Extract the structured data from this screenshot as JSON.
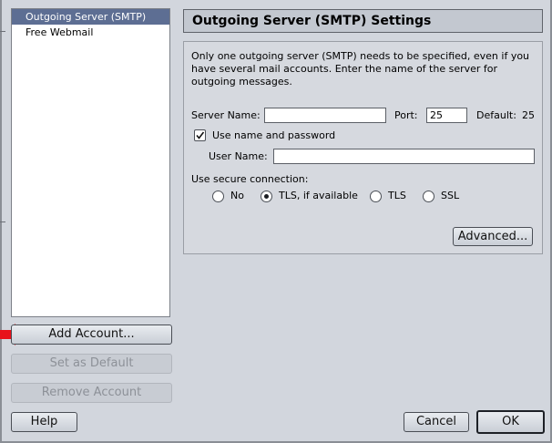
{
  "accounts": {
    "items": [
      {
        "label": "Outgoing Server (SMTP)",
        "selected": true
      },
      {
        "label": "Free Webmail",
        "selected": false
      }
    ]
  },
  "left_buttons": {
    "add": "Add Account...",
    "set_default": "Set as Default",
    "remove": "Remove Account"
  },
  "footer": {
    "help": "Help",
    "cancel": "Cancel",
    "ok": "OK"
  },
  "settings": {
    "title": "Outgoing Server (SMTP) Settings",
    "description": "Only one outgoing server (SMTP) needs to be specified, even if you have several mail accounts. Enter the name of the server for outgoing messages.",
    "server_name_label": "Server Name:",
    "server_name_value": "",
    "port_label": "Port:",
    "port_value": "25",
    "default_label": "Default:",
    "default_value": "25",
    "use_name_password_label": "Use name and password",
    "use_name_password_checked": true,
    "user_name_label": "User Name:",
    "user_name_value": "",
    "secure_label": "Use secure connection:",
    "secure_options": [
      {
        "label": "No",
        "checked": false
      },
      {
        "label": "TLS, if available",
        "checked": true
      },
      {
        "label": "TLS",
        "checked": false
      },
      {
        "label": "SSL",
        "checked": false
      }
    ],
    "advanced_button": "Advanced..."
  },
  "colors": {
    "selection": "#5d6e93",
    "window_background": "#d2d6dd",
    "arrow": "#e8121b"
  },
  "icons": {
    "pointer_arrow": "red-arrow-icon",
    "checkbox_mark": "checkmark-icon"
  }
}
